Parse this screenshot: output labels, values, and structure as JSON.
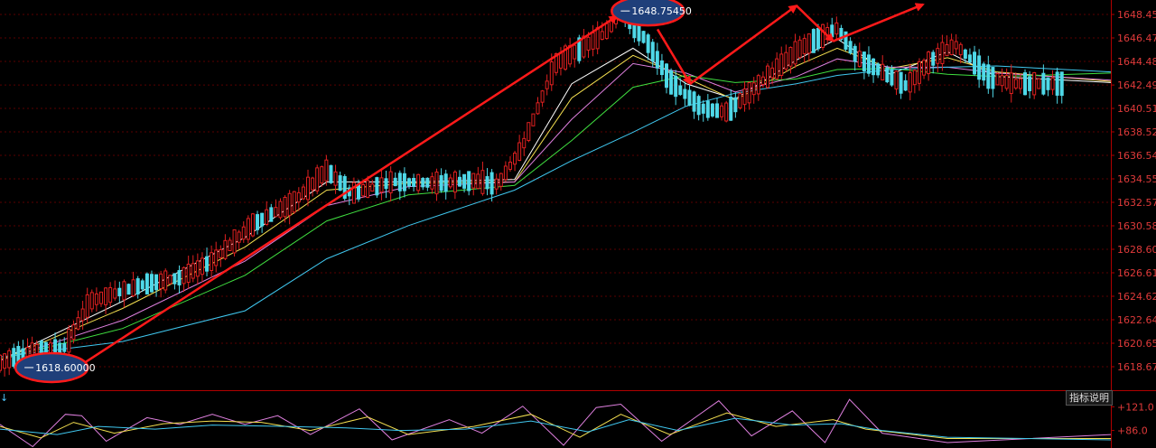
{
  "colors": {
    "background": "#000000",
    "grid": "#5a0000",
    "axis": "#b00000",
    "candle_up": "#e02020",
    "candle_down": "#4fd8e8",
    "ma_colors": [
      "#ffffff",
      "#f5e050",
      "#e080e0",
      "#40e040",
      "#40c8f0"
    ],
    "annotation": "#ff1a1a",
    "marker_fill": "#1f3f7a"
  },
  "chart_data": {
    "type": "line",
    "title": "",
    "xlabel": "",
    "ylabel": "",
    "ylim": [
      1616.7,
      1649.5
    ],
    "y_ticks": [
      "1648.456",
      "1646.471",
      "1644.486",
      "1642.49",
      "1640.514",
      "1638.528",
      "1636.543",
      "1634.557",
      "1632.572",
      "1630.586",
      "1628.600",
      "1626.615",
      "1624.629",
      "1622.644",
      "1620.658",
      "1618.673"
    ],
    "y_tick_values": [
      1648.456,
      1646.471,
      1644.486,
      1642.49,
      1640.514,
      1638.528,
      1636.543,
      1634.557,
      1632.572,
      1630.586,
      1628.6,
      1626.615,
      1624.629,
      1622.644,
      1620.658,
      1618.673
    ],
    "price_path": [
      [
        0,
        1619.0
      ],
      [
        8,
        1620.1
      ],
      [
        16,
        1620.3
      ],
      [
        22,
        1624.2
      ],
      [
        35,
        1625.6
      ],
      [
        44,
        1626.2
      ],
      [
        52,
        1627.6
      ],
      [
        62,
        1630.7
      ],
      [
        72,
        1632.6
      ],
      [
        80,
        1635.3
      ],
      [
        86,
        1633.3
      ],
      [
        96,
        1634.3
      ],
      [
        108,
        1634.2
      ],
      [
        116,
        1634.4
      ],
      [
        122,
        1634.1
      ],
      [
        128,
        1637.3
      ],
      [
        136,
        1644.3
      ],
      [
        148,
        1646.8
      ],
      [
        152,
        1648.6
      ],
      [
        158,
        1646.4
      ],
      [
        164,
        1642.8
      ],
      [
        172,
        1640.5
      ],
      [
        178,
        1640.2
      ],
      [
        186,
        1642.6
      ],
      [
        196,
        1645.6
      ],
      [
        205,
        1647.3
      ],
      [
        210,
        1644.8
      ],
      [
        216,
        1643.6
      ],
      [
        222,
        1642.4
      ],
      [
        228,
        1644.6
      ],
      [
        234,
        1645.9
      ],
      [
        242,
        1643.2
      ],
      [
        248,
        1642.6
      ],
      [
        260,
        1642.6
      ],
      [
        272,
        1642.6
      ]
    ],
    "candle_count": 232,
    "series": [
      {
        "values": [
          [
            0,
            1619.2
          ],
          [
            30,
            1624.2
          ],
          [
            60,
            1629.6
          ],
          [
            80,
            1634.3
          ],
          [
            100,
            1634.3
          ],
          [
            126,
            1634.5
          ],
          [
            140,
            1642.6
          ],
          [
            155,
            1645.6
          ],
          [
            168,
            1642.6
          ],
          [
            180,
            1641.3
          ],
          [
            195,
            1644.6
          ],
          [
            205,
            1646.4
          ],
          [
            218,
            1643.4
          ],
          [
            232,
            1645.3
          ],
          [
            244,
            1643.2
          ],
          [
            272,
            1642.7
          ]
        ]
      },
      {
        "values": [
          [
            0,
            1619.2
          ],
          [
            30,
            1623.6
          ],
          [
            60,
            1628.8
          ],
          [
            80,
            1633.6
          ],
          [
            100,
            1634.2
          ],
          [
            126,
            1634.3
          ],
          [
            140,
            1641.4
          ],
          [
            155,
            1645.0
          ],
          [
            168,
            1643.1
          ],
          [
            180,
            1641.2
          ],
          [
            195,
            1644.1
          ],
          [
            205,
            1645.6
          ],
          [
            218,
            1643.9
          ],
          [
            232,
            1644.8
          ],
          [
            244,
            1643.6
          ],
          [
            272,
            1642.8
          ]
        ]
      },
      {
        "values": [
          [
            0,
            1619.2
          ],
          [
            30,
            1622.6
          ],
          [
            60,
            1627.6
          ],
          [
            80,
            1632.3
          ],
          [
            100,
            1633.9
          ],
          [
            126,
            1634.3
          ],
          [
            140,
            1639.6
          ],
          [
            155,
            1644.3
          ],
          [
            168,
            1643.5
          ],
          [
            180,
            1641.9
          ],
          [
            195,
            1643.2
          ],
          [
            205,
            1644.7
          ],
          [
            218,
            1644.0
          ],
          [
            232,
            1644.0
          ],
          [
            244,
            1643.5
          ],
          [
            272,
            1642.9
          ]
        ]
      },
      {
        "values": [
          [
            0,
            1619.3
          ],
          [
            30,
            1621.9
          ],
          [
            60,
            1626.4
          ],
          [
            80,
            1631.0
          ],
          [
            100,
            1633.2
          ],
          [
            126,
            1634.0
          ],
          [
            140,
            1637.8
          ],
          [
            155,
            1642.3
          ],
          [
            168,
            1643.3
          ],
          [
            180,
            1642.7
          ],
          [
            195,
            1643.0
          ],
          [
            205,
            1643.8
          ],
          [
            218,
            1643.9
          ],
          [
            232,
            1643.4
          ],
          [
            244,
            1643.2
          ],
          [
            272,
            1643.5
          ]
        ]
      },
      {
        "values": [
          [
            0,
            1619.5
          ],
          [
            30,
            1620.8
          ],
          [
            60,
            1623.4
          ],
          [
            80,
            1627.8
          ],
          [
            100,
            1630.6
          ],
          [
            126,
            1633.6
          ],
          [
            140,
            1636.1
          ],
          [
            155,
            1638.5
          ],
          [
            168,
            1640.7
          ],
          [
            180,
            1641.8
          ],
          [
            195,
            1642.6
          ],
          [
            205,
            1643.3
          ],
          [
            218,
            1643.8
          ],
          [
            232,
            1644.0
          ],
          [
            244,
            1644.1
          ],
          [
            272,
            1643.6
          ]
        ]
      }
    ],
    "markers": [
      {
        "label": "1618.60000",
        "x": 6,
        "y": 1618.6
      },
      {
        "label": "1648.75450",
        "x": 152,
        "y": 1648.75
      }
    ],
    "annotations": [
      {
        "from": [
          18,
          1618.4
        ],
        "to": [
          151,
          1648.3
        ]
      },
      {
        "from": [
          161,
          1647.2
        ],
        "to": [
          169,
          1642.6
        ]
      },
      {
        "from": [
          169,
          1642.6
        ],
        "to": [
          195,
          1649.2
        ]
      },
      {
        "from": [
          195,
          1649.2
        ],
        "to": [
          204,
          1646.2
        ]
      },
      {
        "from": [
          204,
          1646.2
        ],
        "to": [
          226,
          1649.3
        ]
      }
    ],
    "oscillator": {
      "y_ticks": [
        "+121.0",
        "+86.0"
      ],
      "y_tick_values": [
        121,
        86
      ],
      "ylim": [
        60,
        135
      ],
      "series": [
        {
          "values": [
            [
              0,
              95
            ],
            [
              8,
              62
            ],
            [
              16,
              110
            ],
            [
              20,
              108
            ],
            [
              26,
              70
            ],
            [
              36,
              105
            ],
            [
              44,
              95
            ],
            [
              52,
              110
            ],
            [
              60,
              95
            ],
            [
              68,
              108
            ],
            [
              76,
              80
            ],
            [
              88,
              118
            ],
            [
              96,
              72
            ],
            [
              110,
              102
            ],
            [
              118,
              82
            ],
            [
              128,
              122
            ],
            [
              138,
              64
            ],
            [
              146,
              120
            ],
            [
              152,
              125
            ],
            [
              162,
              70
            ],
            [
              176,
              130
            ],
            [
              184,
              78
            ],
            [
              194,
              115
            ],
            [
              202,
              68
            ],
            [
              208,
              132
            ],
            [
              216,
              82
            ],
            [
              232,
              68
            ],
            [
              272,
              80
            ]
          ]
        },
        {
          "values": [
            [
              0,
              92
            ],
            [
              10,
              75
            ],
            [
              18,
              98
            ],
            [
              28,
              82
            ],
            [
              40,
              96
            ],
            [
              52,
              100
            ],
            [
              64,
              98
            ],
            [
              76,
              86
            ],
            [
              90,
              106
            ],
            [
              100,
              80
            ],
            [
              116,
              92
            ],
            [
              130,
              110
            ],
            [
              142,
              76
            ],
            [
              152,
              110
            ],
            [
              164,
              80
            ],
            [
              178,
              112
            ],
            [
              190,
              92
            ],
            [
              204,
              102
            ],
            [
              212,
              88
            ],
            [
              232,
              74
            ],
            [
              272,
              74
            ]
          ]
        },
        {
          "values": [
            [
              0,
              88
            ],
            [
              14,
              80
            ],
            [
              24,
              92
            ],
            [
              38,
              88
            ],
            [
              52,
              94
            ],
            [
              70,
              92
            ],
            [
              84,
              90
            ],
            [
              98,
              86
            ],
            [
              114,
              88
            ],
            [
              130,
              100
            ],
            [
              144,
              84
            ],
            [
              154,
              102
            ],
            [
              166,
              86
            ],
            [
              180,
              104
            ],
            [
              194,
              94
            ],
            [
              206,
              96
            ],
            [
              216,
              86
            ],
            [
              232,
              76
            ],
            [
              272,
              72
            ]
          ]
        }
      ]
    }
  },
  "ui": {
    "indicator_button_label": "指标说明",
    "scroll_arrow": "↓"
  }
}
